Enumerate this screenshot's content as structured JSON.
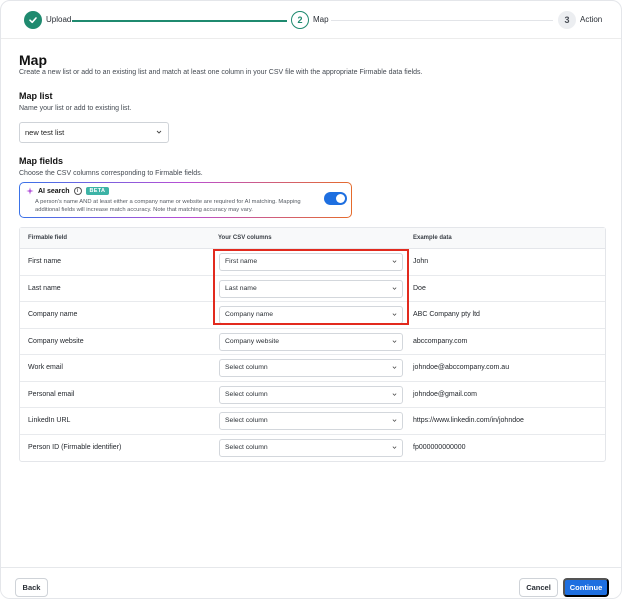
{
  "stepper": {
    "steps": [
      {
        "number": "",
        "label": "Upload",
        "state": "complete"
      },
      {
        "number": "2",
        "label": "Map",
        "state": "active"
      },
      {
        "number": "3",
        "label": "Action",
        "state": "upcoming"
      }
    ]
  },
  "page": {
    "title": "Map",
    "subtitle": "Create a new list or add to an existing list and match at least one column in your CSV file with the appropriate Firmable data fields."
  },
  "map_list": {
    "heading": "Map list",
    "description": "Name your list or add to existing list.",
    "selected_value": "new test list"
  },
  "map_fields": {
    "heading": "Map fields",
    "description": "Choose the CSV columns corresponding to Firmable fields."
  },
  "ai_search": {
    "label": "AI search",
    "badge": "BETA",
    "description": "A person's name AND at least either a company name or website are required for AI matching. Mapping additional fields will increase match accuracy. Note that matching accuracy may vary.",
    "enabled": true
  },
  "table": {
    "headers": [
      "Firmable field",
      "Your CSV columns",
      "Example data"
    ],
    "rows": [
      {
        "field": "First name",
        "column": "First name",
        "example": "John"
      },
      {
        "field": "Last name",
        "column": "Last name",
        "example": "Doe"
      },
      {
        "field": "Company name",
        "column": "Company name",
        "example": "ABC Company pty ltd"
      },
      {
        "field": "Company website",
        "column": "Company website",
        "example": "abccompany.com"
      },
      {
        "field": "Work email",
        "column": "Select column",
        "example": "johndoe@abccompany.com.au"
      },
      {
        "field": "Personal email",
        "column": "Select column",
        "example": "johndoe@gmail.com"
      },
      {
        "field": "LinkedIn URL",
        "column": "Select column",
        "example": "https://www.linkedin.com/in/johndoe"
      },
      {
        "field": "Person ID (Firmable identifier)",
        "column": "Select column",
        "example": "fp000000000000"
      }
    ]
  },
  "footer": {
    "back_label": "Back",
    "cancel_label": "Cancel",
    "continue_label": "Continue"
  },
  "colors": {
    "accent_green": "#1f8a6f",
    "primary_blue": "#1e6fe0",
    "highlight_red": "#e22a1e",
    "beta_teal": "#3db3a6"
  },
  "icons": [
    "check-icon",
    "chevron-down-icon",
    "sparkle-icon",
    "info-icon"
  ]
}
